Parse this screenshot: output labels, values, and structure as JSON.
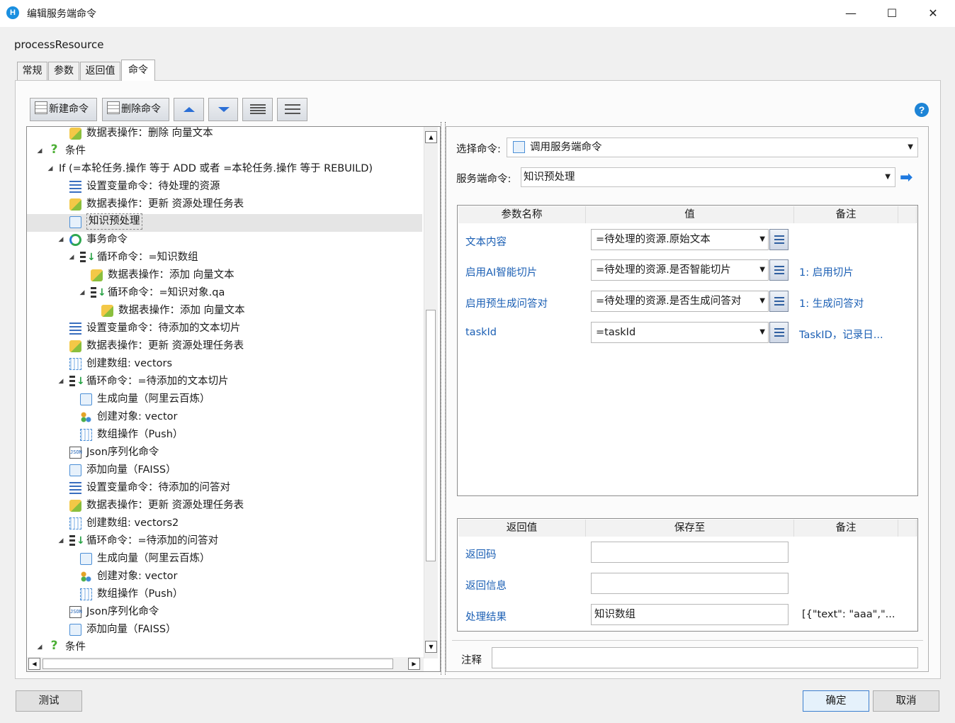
{
  "window": {
    "title": "编辑服务端命令",
    "minimize": "—",
    "maximize": "☐",
    "close": "✕",
    "app_icon": "H"
  },
  "command_name": "processResource",
  "tabs": [
    {
      "label": "常规",
      "active": false
    },
    {
      "label": "参数",
      "active": false
    },
    {
      "label": "返回值",
      "active": false
    },
    {
      "label": "命令",
      "active": true
    }
  ],
  "toolbar": {
    "new_label": "新建命令",
    "delete_label": "删除命令",
    "icons": [
      "move-up-icon",
      "move-down-icon",
      "indent-icon",
      "outdent-icon"
    ]
  },
  "help_icon": "?",
  "tree": [
    {
      "level": 4,
      "icon": "db",
      "text": "数据表操作：删除 向量文本"
    },
    {
      "level": 2,
      "icon": "q",
      "text": "条件",
      "expanded": true
    },
    {
      "level": 3,
      "icon": "if",
      "text": "If   (=本轮任务.操作 等于 ADD 或者 =本轮任务.操作 等于 REBUILD)",
      "expanded": true
    },
    {
      "level": 4,
      "icon": "var",
      "text": "设置变量命令：待处理的资源"
    },
    {
      "level": 4,
      "icon": "db",
      "text": "数据表操作：更新 资源处理任务表"
    },
    {
      "level": 4,
      "icon": "cmd",
      "text": "知识预处理",
      "selected": true
    },
    {
      "level": 4,
      "icon": "tx",
      "text": "事务命令",
      "expanded": true
    },
    {
      "level": 5,
      "icon": "loop",
      "text": "循环命令：=知识数组",
      "expanded": true
    },
    {
      "level": 6,
      "icon": "db",
      "text": "数据表操作：添加 向量文本"
    },
    {
      "level": 6,
      "icon": "loop",
      "text": "循环命令：=知识对象.qa",
      "expanded": true
    },
    {
      "level": 7,
      "icon": "db",
      "text": "数据表操作：添加 向量文本"
    },
    {
      "level": 4,
      "icon": "var",
      "text": "设置变量命令：待添加的文本切片"
    },
    {
      "level": 4,
      "icon": "db",
      "text": "数据表操作：更新 资源处理任务表"
    },
    {
      "level": 4,
      "icon": "arr",
      "text": "创建数组:  vectors"
    },
    {
      "level": 4,
      "icon": "loop",
      "text": "循环命令：=待添加的文本切片",
      "expanded": true
    },
    {
      "level": 5,
      "icon": "cmd",
      "text": "生成向量（阿里云百炼）"
    },
    {
      "level": 5,
      "icon": "obj",
      "text": "创建对象:  vector"
    },
    {
      "level": 5,
      "icon": "arr",
      "text": "数组操作（Push）"
    },
    {
      "level": 4,
      "icon": "json",
      "text": "Json序列化命令"
    },
    {
      "level": 4,
      "icon": "cmd",
      "text": "添加向量（FAISS）"
    },
    {
      "level": 4,
      "icon": "var",
      "text": "设置变量命令：待添加的问答对"
    },
    {
      "level": 4,
      "icon": "db",
      "text": "数据表操作：更新 资源处理任务表"
    },
    {
      "level": 4,
      "icon": "arr",
      "text": "创建数组:  vectors2"
    },
    {
      "level": 4,
      "icon": "loop",
      "text": "循环命令：=待添加的问答对",
      "expanded": true
    },
    {
      "level": 5,
      "icon": "cmd",
      "text": "生成向量（阿里云百炼）"
    },
    {
      "level": 5,
      "icon": "obj",
      "text": "创建对象:  vector"
    },
    {
      "level": 5,
      "icon": "arr",
      "text": "数组操作（Push）"
    },
    {
      "level": 4,
      "icon": "json",
      "text": "Json序列化命令"
    },
    {
      "level": 4,
      "icon": "cmd",
      "text": "添加向量（FAISS）"
    },
    {
      "level": 2,
      "icon": "q",
      "text": "条件",
      "expanded": true
    }
  ],
  "right": {
    "select_cmd_label": "选择命令:",
    "select_cmd_value": "调用服务端命令",
    "server_cmd_label": "服务端命令:",
    "server_cmd_value": "知识预处理",
    "param_headers": [
      "参数名称",
      "值",
      "备注"
    ],
    "params": [
      {
        "name": "文本内容",
        "value": "=待处理的资源.原始文本",
        "note": ""
      },
      {
        "name": "启用AI智能切片",
        "value": "=待处理的资源.是否智能切片",
        "note": "1:  启用切片"
      },
      {
        "name": "启用预生成问答对",
        "value": "=待处理的资源.是否生成问答对",
        "note": "1:  生成问答对"
      },
      {
        "name": "taskId",
        "value": "=taskId",
        "note": "TaskID，记录日..."
      }
    ],
    "return_headers": [
      "返回值",
      "保存至",
      "备注"
    ],
    "returns": [
      {
        "name": "返回码",
        "value": "",
        "note": ""
      },
      {
        "name": "返回信息",
        "value": "",
        "note": ""
      },
      {
        "name": "处理结果",
        "value": "知识数组",
        "note": "[{\"text\": \"aaa\",\"..."
      }
    ],
    "comment_label": "注释",
    "comment_value": ""
  },
  "bottom": {
    "test_label": "测试",
    "ok_label": "确定",
    "cancel_label": "取消"
  }
}
